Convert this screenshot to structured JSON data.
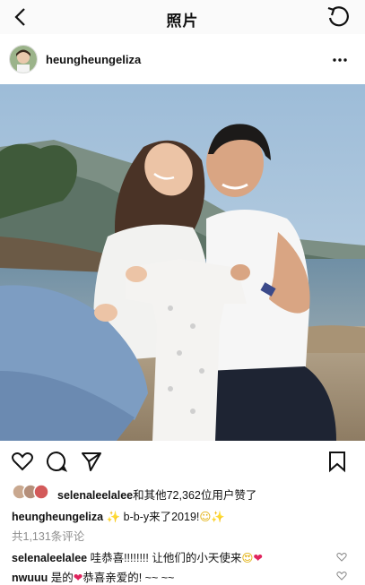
{
  "topbar": {
    "title": "照片",
    "back_icon": "chevron-left-icon",
    "refresh_icon": "refresh-icon"
  },
  "post": {
    "username": "heungheungeliza",
    "more_icon": "more-horizontal-icon"
  },
  "actions": {
    "like_icon": "heart-outline-icon",
    "comment_icon": "comment-bubble-icon",
    "share_icon": "paper-plane-icon",
    "save_icon": "bookmark-icon"
  },
  "likes": {
    "first_user": "selenaleelalee",
    "suffix": "和其他72,362位用户赞了"
  },
  "caption": {
    "username": "heungheungeliza",
    "sparkle": "✨",
    "text": " b-b-y来了2019!",
    "emoji_smile": "☺",
    "sparkle_end": "✨"
  },
  "comment_count": "共1,131条评论",
  "comments": [
    {
      "username": "selenaleelalee",
      "text": " 哇恭喜!!!!!!!! 让他们的小天使来",
      "emoji_a": "😍",
      "emoji_b": "❤"
    },
    {
      "username": "nwuuu",
      "text_a": " 是的",
      "emoji": "❤",
      "text_b": "恭喜亲爱的! ~~ ~~"
    }
  ],
  "colors": {
    "accent_red": "#e0245e",
    "muted": "#8e8e8e",
    "topbar_bg": "#fafafa"
  }
}
